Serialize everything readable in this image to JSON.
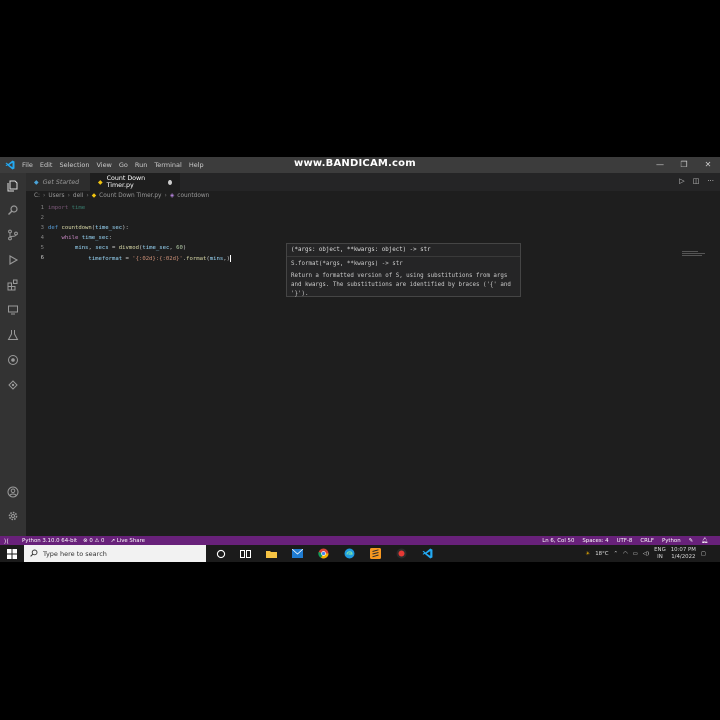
{
  "titlebar": {
    "menu": [
      "File",
      "Edit",
      "Selection",
      "View",
      "Go",
      "Run",
      "Terminal",
      "Help"
    ],
    "watermark": "www.BANDICAM.com",
    "controls": [
      "—",
      "❐",
      "✕"
    ]
  },
  "tabs": [
    {
      "label": "Get Started"
    },
    {
      "label": "Count Down Timer.py"
    }
  ],
  "breadcrumb": [
    "C:",
    "Users",
    "dell",
    "Count Down Timer.py",
    "countdown"
  ],
  "code": {
    "line_numbers": [
      "1",
      "2",
      "3",
      "4",
      "5",
      "6"
    ],
    "l1_kw": "import",
    "l1_mod": "time",
    "l3_kw": "def",
    "l3_fn": "countdown",
    "l3_paren": "(",
    "l3_arg": "time_sec",
    "l3_end": "):",
    "l4_kw": "while",
    "l4_var": "time_sec",
    "l4_end": ":",
    "l5_a": "mins",
    "l5_b": ", ",
    "l5_c": "secs",
    "l5_d": " = ",
    "l5_fn": "divmod",
    "l5_e": "(",
    "l5_f": "time_sec",
    "l5_g": ", ",
    "l5_num": "60",
    "l5_h": ")",
    "l6_a": "timeformat",
    "l6_b": " = ",
    "l6_str": "'{:02d}:{:02d}'",
    "l6_c": ".",
    "l6_fn": "format",
    "l6_d": "(",
    "l6_e": "mins",
    "l6_f": ",)"
  },
  "hover": {
    "signature": "(*args: object, **kwargs: object) -> str",
    "signature2": "S.format(*args, **kwargs) -> str",
    "description": "Return a formatted version of S, using substitutions from args and kwargs. The substitutions are identified by braces ('{' and '}')."
  },
  "statusbar": {
    "python": "Python 3.10.0 64-bit",
    "problems": "⊗ 0 ⚠ 0",
    "liveshare": "Live Share",
    "position": "Ln 6, Col 50",
    "spaces": "Spaces: 4",
    "encoding": "UTF-8",
    "eol": "CRLF",
    "language": "Python"
  },
  "taskbar": {
    "search_placeholder": "Type here to search",
    "weather": "18°C",
    "lang1": "ENG",
    "lang2": "IN",
    "time": "10:07 PM",
    "date": "1/4/2022"
  },
  "colors": {
    "statusbar": "#68217a",
    "editor_bg": "#1e1e1e",
    "activity_bg": "#333333"
  }
}
